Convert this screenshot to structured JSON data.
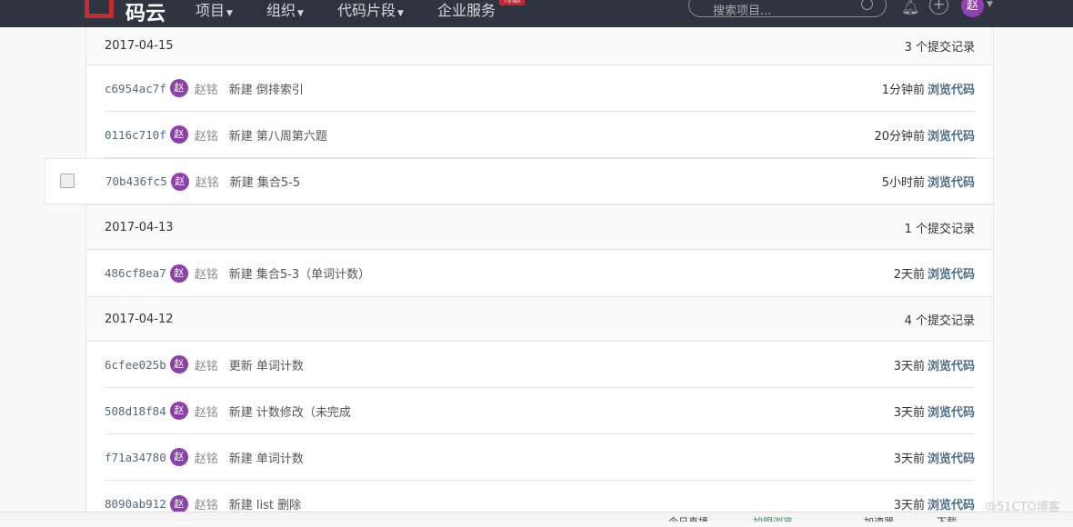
{
  "header": {
    "logo": "码云",
    "nav": [
      "项目",
      "组织",
      "代码片段",
      "企业服务"
    ],
    "badge": "特惠",
    "search_placeholder": "搜索项目...",
    "avatar": "赵"
  },
  "groups": [
    {
      "date": "2017-04-15",
      "count": "3 个提交记录",
      "commits": [
        {
          "sha": "c6954ac7f",
          "author": "赵铭",
          "message": "新建 倒排索引",
          "time": "1分钟前"
        },
        {
          "sha": "0116c710f",
          "author": "赵铭",
          "message": "新建 第八周第六题",
          "time": "20分钟前"
        },
        {
          "sha": "70b436fc5",
          "author": "赵铭",
          "message": "新建 集合5-5",
          "time": "5小时前"
        }
      ]
    },
    {
      "date": "2017-04-13",
      "count": "1 个提交记录",
      "commits": [
        {
          "sha": "486cf8ea7",
          "author": "赵铭",
          "message": "新建 集合5-3（单词计数）",
          "time": "2天前"
        }
      ]
    },
    {
      "date": "2017-04-12",
      "count": "4 个提交记录",
      "commits": [
        {
          "sha": "6cfee025b",
          "author": "赵铭",
          "message": "更新 单词计数",
          "time": "3天前"
        },
        {
          "sha": "508d18f84",
          "author": "赵铭",
          "message": "新建 计数修改（未完成",
          "time": "3天前"
        },
        {
          "sha": "f71a34780",
          "author": "赵铭",
          "message": "新建 单词计数",
          "time": "3天前"
        },
        {
          "sha": "8090ab912",
          "author": "赵铭",
          "message": "新建 list 删除",
          "time": "3天前"
        }
      ]
    }
  ],
  "avatar_letter": "赵",
  "browse_label": "浏览代码",
  "status_bar": [
    "今日直播",
    "护眼浏览",
    "加速器",
    "下载"
  ],
  "watermark": "@51CTO博客"
}
